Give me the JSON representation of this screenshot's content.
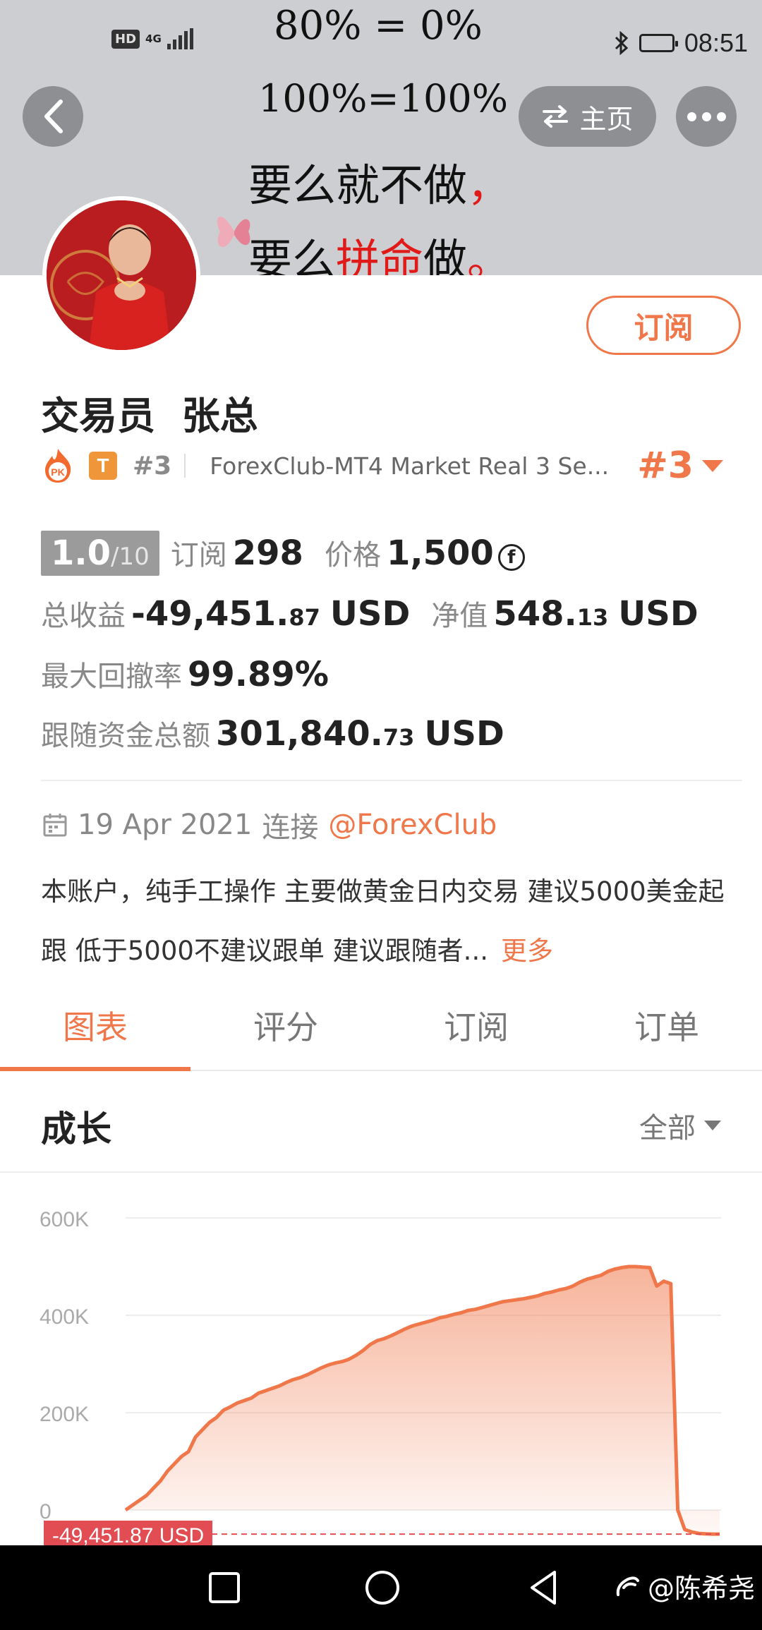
{
  "status_bar": {
    "hd": "HD",
    "network": "4G",
    "time": "08:51",
    "icons": [
      "signal-icon",
      "bluetooth-icon",
      "battery-icon"
    ]
  },
  "banner": {
    "line1": "80% = 0%",
    "line2": "100%=100%",
    "line3_main": "要么就不做",
    "line3_punct": "，",
    "line4_pre": "要么",
    "line4_red": "拼命",
    "line4_post": "做",
    "line4_punct": "。",
    "home_label": "主页"
  },
  "profile": {
    "name": "交易员  张总",
    "subscribe_label": "订阅",
    "t_badge": "T",
    "rank_small": "#3",
    "broker": "ForexClub-MT4 Market Real 3 Se...",
    "rank_big": "#3"
  },
  "stats": {
    "score": "1.0",
    "score_max": "/10",
    "subs_label": "订阅",
    "subs_value": "298",
    "price_label": "价格",
    "price_value": "1,500",
    "coin_symbol": "f",
    "total_profit_label": "总收益",
    "total_profit_main": "-49,451.",
    "total_profit_cents": "87",
    "total_profit_unit": "USD",
    "equity_label": "净值",
    "equity_main": "548.",
    "equity_cents": "13",
    "equity_unit": "USD",
    "max_dd_label": "最大回撤率",
    "max_dd_value": "99.89%",
    "follow_label": "跟随资金总额",
    "follow_main": "301,840.",
    "follow_cents": "73",
    "follow_unit": "USD"
  },
  "connection": {
    "date": "19 Apr 2021",
    "label": "连接",
    "broker_link": "@ForexClub"
  },
  "description": {
    "text": "本账户，纯手工操作 主要做黄金日内交易 建议5000美金起跟 低于5000不建议跟单 建议跟随者...",
    "more": "更多"
  },
  "tabs": [
    {
      "label": "图表",
      "active": true
    },
    {
      "label": "评分",
      "active": false
    },
    {
      "label": "订阅",
      "active": false
    },
    {
      "label": "订单",
      "active": false
    }
  ],
  "chart_card": {
    "title": "成长",
    "range": "全部",
    "balance_tag": "-49,451.87 USD"
  },
  "chart_data": {
    "type": "area",
    "title": "成长",
    "y_ticks": [
      "600K",
      "400K",
      "200K",
      "0"
    ],
    "ylim": [
      -60000,
      600000
    ],
    "grid": true,
    "color": "#f0774a",
    "x": [
      0,
      1,
      2,
      3,
      4,
      5,
      6,
      7,
      8,
      9,
      10,
      11,
      12,
      13,
      14,
      15,
      16,
      17,
      18,
      19,
      20,
      21,
      22,
      23,
      24,
      25,
      26,
      27,
      28,
      29,
      30,
      31,
      32,
      33,
      34,
      35,
      36,
      37,
      38,
      39,
      40,
      41,
      42,
      43,
      44,
      45,
      46,
      47,
      48,
      49,
      50,
      51,
      52,
      53,
      54,
      55,
      56,
      57,
      58,
      59,
      60,
      61,
      62,
      63,
      64,
      65,
      66,
      67,
      68,
      69,
      70,
      71,
      72,
      73,
      74,
      75,
      76,
      77,
      78,
      79,
      80,
      81,
      82,
      83,
      84,
      85,
      86,
      87,
      88,
      89,
      90,
      91,
      92,
      93,
      94,
      95,
      96,
      97,
      98,
      99,
      100
    ],
    "values": [
      0,
      10000,
      20000,
      30000,
      45000,
      60000,
      80000,
      95000,
      110000,
      120000,
      150000,
      165000,
      180000,
      190000,
      205000,
      212000,
      220000,
      225000,
      230000,
      240000,
      245000,
      250000,
      255000,
      262000,
      268000,
      272000,
      278000,
      285000,
      292000,
      298000,
      302000,
      305000,
      310000,
      318000,
      328000,
      340000,
      348000,
      352000,
      358000,
      365000,
      372000,
      378000,
      382000,
      386000,
      390000,
      395000,
      398000,
      402000,
      405000,
      410000,
      412000,
      416000,
      420000,
      424000,
      428000,
      430000,
      432000,
      434000,
      437000,
      440000,
      445000,
      448000,
      452000,
      455000,
      460000,
      468000,
      474000,
      478000,
      482000,
      490000,
      495000,
      498000,
      500000,
      500000,
      499000,
      498000,
      460000,
      470000,
      465000,
      0,
      -40000,
      -45000,
      -48000,
      -49000,
      -49451.87,
      -49451.87
    ],
    "baseline_value": -49451.87
  },
  "navbar": {
    "watermark": "@陈希尧",
    "icons": [
      "recent-apps-icon",
      "home-circle-icon",
      "back-triangle-icon"
    ]
  }
}
